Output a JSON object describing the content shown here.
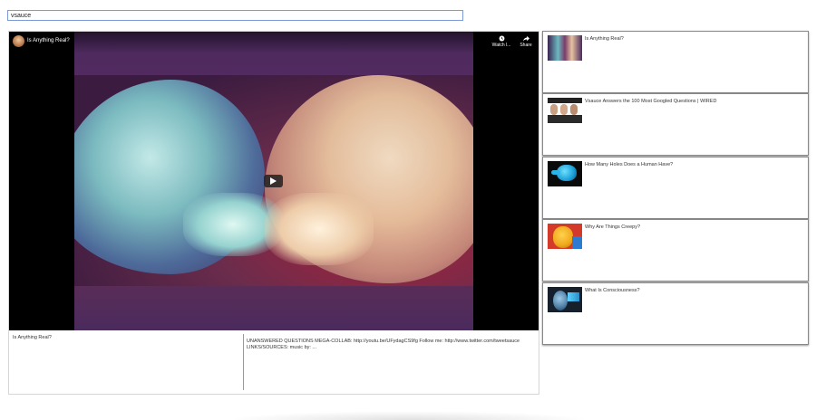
{
  "search": {
    "value": "vsauce"
  },
  "player": {
    "video_title": "Is Anything Real?",
    "watch_later_label": "Watch l...",
    "share_label": "Share",
    "channel_avatar_icon": "vsauce-avatar",
    "play_icon": "play-icon"
  },
  "info": {
    "title": "Is Anything Real?",
    "description": "UNANSWERED QUESTIONS MEGA-COLLAB: http://youtu.be/UFydagCS9fg Follow me: http://www.twitter.com/tweetsauce LINKS/SOURCES: music by: ..."
  },
  "results": [
    {
      "title": "Is Anything Real?"
    },
    {
      "title": "Vsauce Answers the 100 Most Googled Questions | WIRED"
    },
    {
      "title": "How Many Holes Does a Human Have?"
    },
    {
      "title": "Why Are Things Creepy?"
    },
    {
      "title": "What Is Consciousness?"
    }
  ]
}
